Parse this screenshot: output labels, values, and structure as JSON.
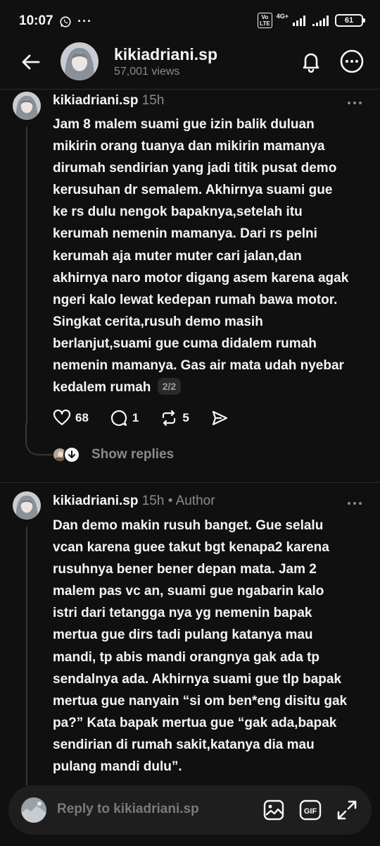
{
  "status_bar": {
    "time": "10:07",
    "network": "4G+",
    "volte": "Vo LTE",
    "battery": "61"
  },
  "header": {
    "username": "kikiadriani.sp",
    "views": "57,001 views"
  },
  "posts": [
    {
      "username": "kikiadriani.sp",
      "time": "15h",
      "author_tag": "",
      "lines": [
        "Jam 8 malem suami gue izin balik duluan",
        "mikirin orang tuanya dan mikirin mamanya",
        "dirumah sendirian yang jadi titik pusat demo",
        "kerusuhan dr semalem. Akhirnya suami gue",
        "ke rs dulu nengok bapaknya,setelah itu",
        "kerumah nemenin mamanya. Dari rs pelni",
        "kerumah aja muter muter cari jalan,dan",
        "akhirnya naro motor digang asem karena agak",
        "ngeri kalo lewat kedepan rumah bawa motor.",
        "Singkat cerita,rusuh demo masih",
        "berlanjut,suami gue cuma didalem rumah",
        "nemenin mamanya. Gas air mata udah nyebar",
        "kedalem rumah"
      ],
      "page_badge": "2/2",
      "likes": "68",
      "comments": "1",
      "reposts": "5",
      "show_replies": "Show replies"
    },
    {
      "username": "kikiadriani.sp",
      "time": "15h",
      "author_tag": "• Author",
      "lines": [
        "Dan demo makin rusuh banget. Gue selalu",
        "vcan karena guee takut bgt kenapa2 karena",
        "rusuhnya bener bener depan mata. Jam 2",
        "malem pas vc an, suami gue ngabarin kalo",
        "istri dari tetangga nya yg nemenin bapak",
        "mertua gue dirs tadi pulang katanya mau",
        "mandi, tp abis mandi orangnya gak ada tp",
        "sendalnya ada. Akhirnya suami gue tlp bapak",
        "mertua gue nanyain “si om ben*eng disitu gak",
        "pa?” Kata bapak mertua gue “gak ada,bapak",
        "sendirian di rumah sakit,katanya dia mau",
        "pulang mandi dulu”."
      ]
    }
  ],
  "reply_bar": {
    "placeholder": "Reply to kikiadriani.sp",
    "gif_label": "GIF"
  },
  "icons": {
    "back": "arrow-left-icon",
    "bell": "bell-icon",
    "more": "more-horizontal-icon",
    "like": "heart-icon",
    "comment": "comment-icon",
    "repost": "repost-icon",
    "share": "send-icon",
    "image": "image-icon",
    "gif": "gif-icon",
    "expand": "expand-icon"
  },
  "colors": {
    "background": "#101010",
    "text_primary": "#f3f5f7",
    "text_secondary": "#8a8a8a",
    "reply_bar": "#1e1e1e"
  }
}
